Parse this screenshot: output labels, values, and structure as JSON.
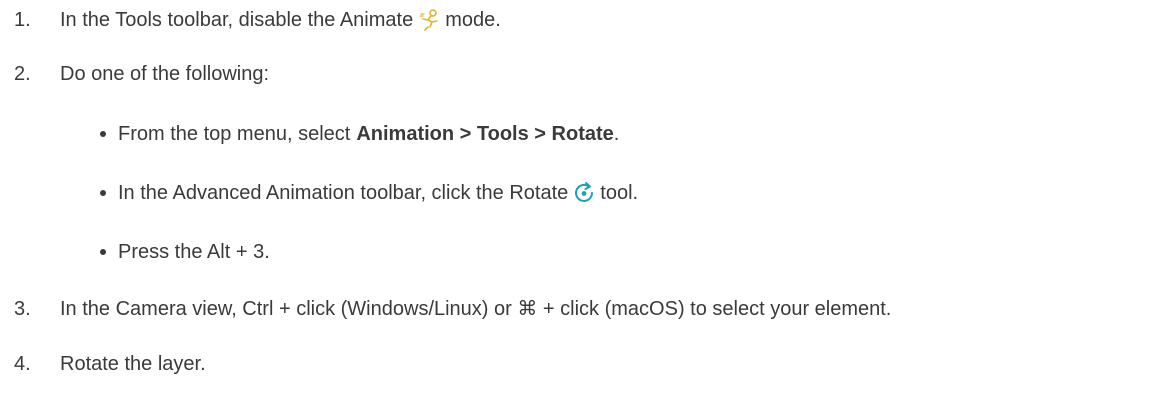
{
  "steps": [
    {
      "num": "1.",
      "pre": "In the Tools toolbar, disable the Animate",
      "post": "mode."
    },
    {
      "num": "2.",
      "text": "Do one of the following:",
      "options": [
        {
          "pre": "From the top menu, select ",
          "bold": "Animation > Tools > Rotate",
          "post": "."
        },
        {
          "pre": "In the Advanced Animation toolbar, click the Rotate",
          "post": "tool."
        },
        {
          "text": "Press the Alt + 3."
        }
      ]
    },
    {
      "num": "3.",
      "text": "In the Camera view, Ctrl + click (Windows/Linux) or ⌘ + click (macOS) to select your element."
    },
    {
      "num": "4.",
      "text": "Rotate the layer."
    }
  ],
  "icons": {
    "animate": "animate-icon",
    "rotate": "rotate-tool-icon"
  },
  "colors": {
    "animate_icon": "#e8b12a",
    "rotate_icon": "#1e9fb5",
    "text": "#3a3a3a"
  }
}
